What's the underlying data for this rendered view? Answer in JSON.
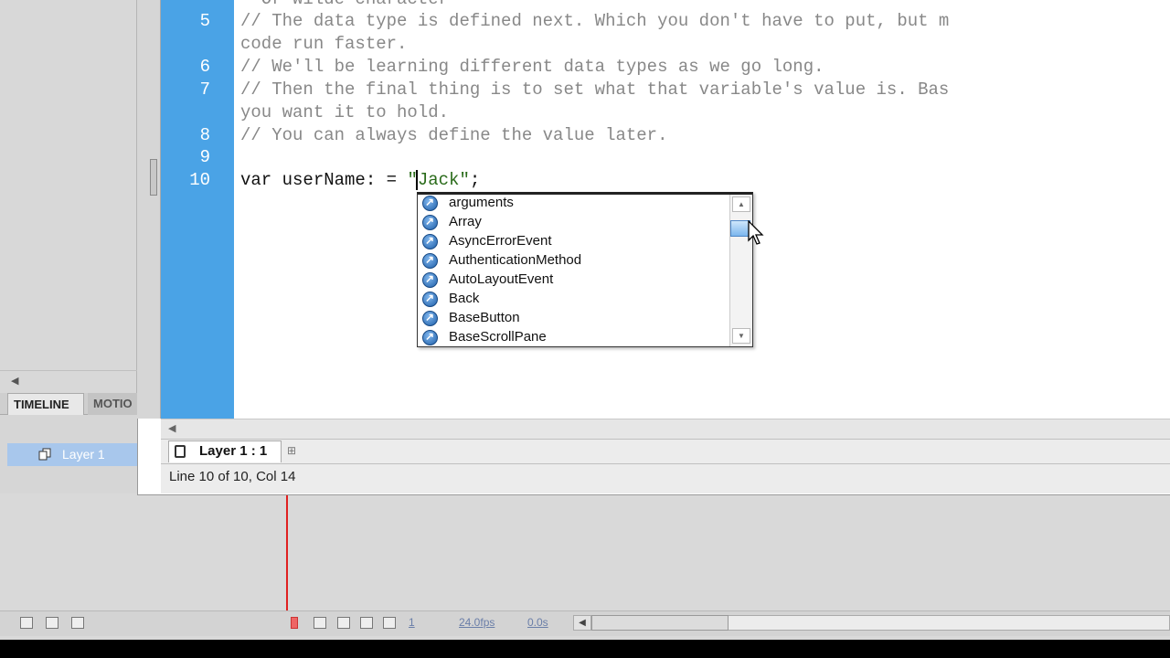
{
  "editor": {
    "lines": [
      {
        "num": "",
        "text": "  Or wilde character"
      },
      {
        "num": "5",
        "text": "// The data type is defined next. Which you don't have to put, but m"
      },
      {
        "num": "",
        "text": "code run faster."
      },
      {
        "num": "6",
        "text": "// We'll be learning different data types as we go long."
      },
      {
        "num": "7",
        "text": "// Then the final thing is to set what that variable's value is. Bas"
      },
      {
        "num": "",
        "text": "you want it to hold."
      },
      {
        "num": "8",
        "text": "// You can always define the value later."
      },
      {
        "num": "9",
        "text": ""
      },
      {
        "num": "10",
        "text_before": "var userName:",
        "text_after": " = ",
        "string": "\"Jack\"",
        "end": ";"
      }
    ]
  },
  "code_hint": {
    "items": [
      "arguments",
      "Array",
      "AsyncErrorEvent",
      "AuthenticationMethod",
      "AutoLayoutEvent",
      "Back",
      "BaseButton",
      "BaseScrollPane"
    ]
  },
  "script_tab": {
    "label": "Layer 1 : 1"
  },
  "status": {
    "text": "Line 10 of 10, Col 14"
  },
  "timeline": {
    "tab_timeline": "TIMELINE",
    "tab_motion": "MOTIO",
    "layer_name": "Layer 1",
    "frame": "1",
    "fps": "24.0fps",
    "time": "0.0s"
  },
  "colors": {
    "gutter": "#4aa3e6",
    "selected_layer": "#a8c7ec",
    "playhead": "#e02020"
  }
}
